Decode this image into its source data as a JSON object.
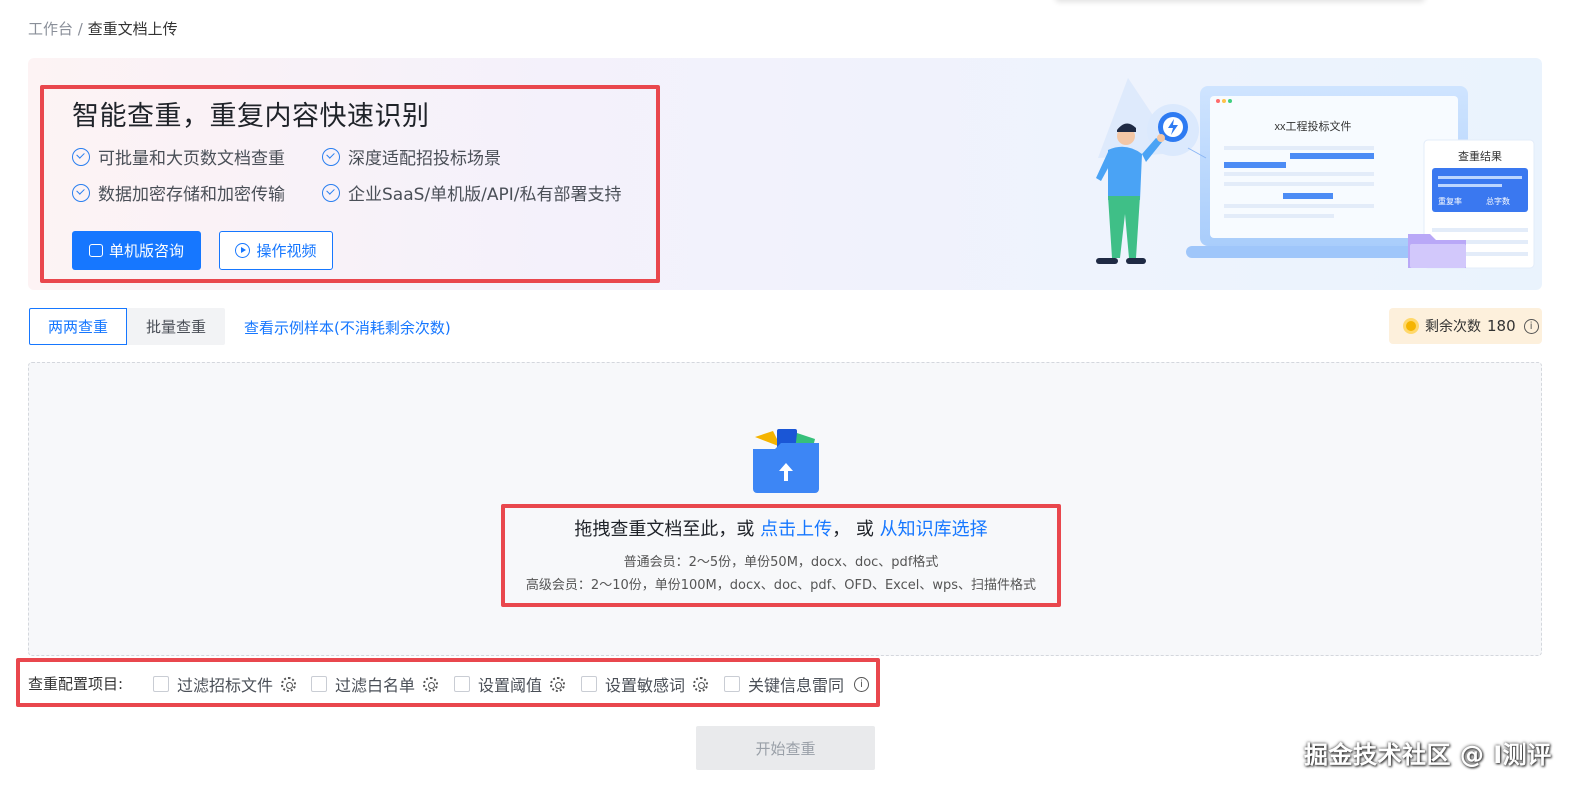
{
  "breadcrumb": {
    "root": "工作台",
    "separator": " / ",
    "current": "查重文档上传"
  },
  "banner": {
    "title": "智能查重，重复内容快速识别",
    "features": [
      "可批量和大页数文档查重",
      "深度适配招投标场景",
      "数据加密存储和加密传输",
      "企业SaaS/单机版/API/私有部署支持"
    ],
    "consult_button": "单机版咨询",
    "video_button": "操作视频",
    "illustration": {
      "doc_title": "xx工程投标文件",
      "result_title": "查重结果",
      "result_label_1": "重复率",
      "result_label_2": "总字数"
    }
  },
  "tabs": {
    "pair": "两两查重",
    "batch": "批量查重"
  },
  "sample_link": "查看示例样本(不消耗剩余次数)",
  "remaining": {
    "label": "剩余次数",
    "count": "180"
  },
  "upload": {
    "prefix": "拖拽查重文档至此，或 ",
    "click_upload": "点击上传",
    "middle": "，  或 ",
    "from_kb": "从知识库选择",
    "normal_member": "普通会员：2～5份，单份50M，docx、doc、pdf格式",
    "premium_member": "高级会员：2～10份，单份100M，docx、doc、pdf、OFD、Excel、wps、扫描件格式"
  },
  "config": {
    "label": "查重配置项目:",
    "options": [
      "过滤招标文件",
      "过滤白名单",
      "设置阈值",
      "设置敏感词",
      "关键信息雷同"
    ]
  },
  "start_button": "开始查重",
  "watermark": "掘金技术社区 @ I测评",
  "colors": {
    "primary": "#1677ff",
    "highlight_box": "#e9474d",
    "remaining_bg": "#fdf0dc"
  }
}
